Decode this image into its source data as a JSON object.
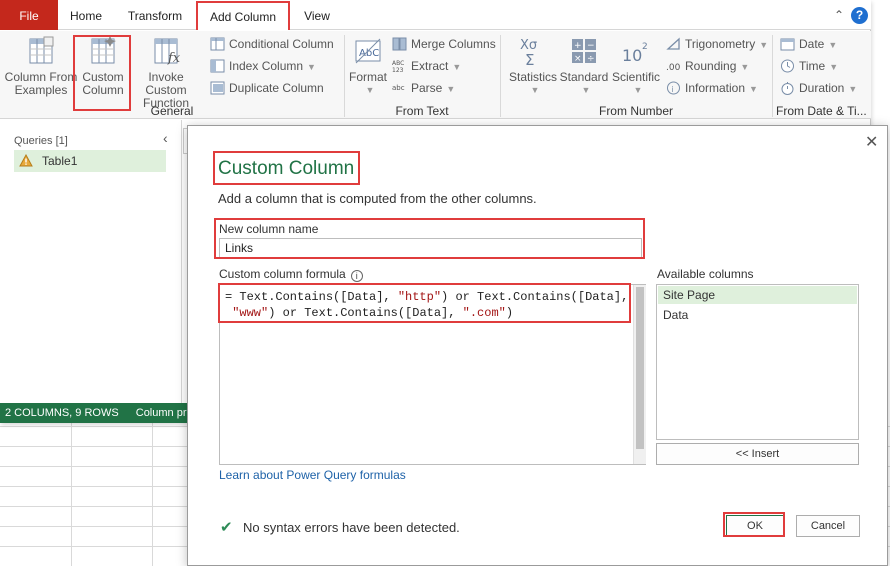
{
  "tabs": {
    "file": "File",
    "home": "Home",
    "transform": "Transform",
    "add_column": "Add Column",
    "view": "View"
  },
  "window": {
    "help_label": "?"
  },
  "ribbon": {
    "general": {
      "label": "General",
      "column_from_examples": [
        "Column From",
        "Examples"
      ],
      "custom_column": [
        "Custom",
        "Column"
      ],
      "invoke_custom_function": [
        "Invoke Custom",
        "Function"
      ],
      "conditional_column": "Conditional Column",
      "index_column": "Index Column",
      "duplicate_column": "Duplicate Column"
    },
    "from_text": {
      "label": "From Text",
      "format": "Format",
      "merge_columns": "Merge Columns",
      "extract": "Extract",
      "parse": "Parse"
    },
    "from_number": {
      "label": "From Number",
      "statistics": "Statistics",
      "standard": "Standard",
      "scientific": "Scientific",
      "trigonometry": "Trigonometry",
      "rounding": "Rounding",
      "information": "Information"
    },
    "from_date_time": {
      "label": "From Date & Ti...",
      "date": "Date",
      "time": "Time",
      "duration": "Duration"
    }
  },
  "queries": {
    "title": "Queries [1]",
    "items": [
      {
        "label": "Table1"
      }
    ]
  },
  "status_bar": {
    "columns_rows": "2 COLUMNS, 9 ROWS",
    "column_profiling": "Column profi"
  },
  "dialog": {
    "title": "Custom Column",
    "subtitle": "Add a column that is computed from the other columns.",
    "new_column_name_label": "New column name",
    "new_column_name_value": "Links",
    "formula_label": "Custom column formula",
    "formula_line1_a": "= Text.Contains([Data], ",
    "formula_line1_b": "\"http\"",
    "formula_line1_c": ") or Text.Contains([Data],",
    "formula_line2_a": "\"www\"",
    "formula_line2_b": ") or Text.Contains([Data], ",
    "formula_line2_c": "\".com\"",
    "formula_line2_d": ")",
    "available_columns_label": "Available columns",
    "available_columns": [
      {
        "label": "Site Page",
        "selected": true
      },
      {
        "label": "Data",
        "selected": false
      }
    ],
    "insert_button": "<< Insert",
    "learn_link": "Learn about Power Query formulas",
    "status_message": "No syntax errors have been detected.",
    "ok_button": "OK",
    "cancel_button": "Cancel"
  },
  "colors": {
    "accent_green": "#217346",
    "file_tab_red": "#c4281c",
    "highlight_red": "#e03c3c",
    "link_blue": "#1e62a8",
    "selection_green": "#dff0dc"
  }
}
